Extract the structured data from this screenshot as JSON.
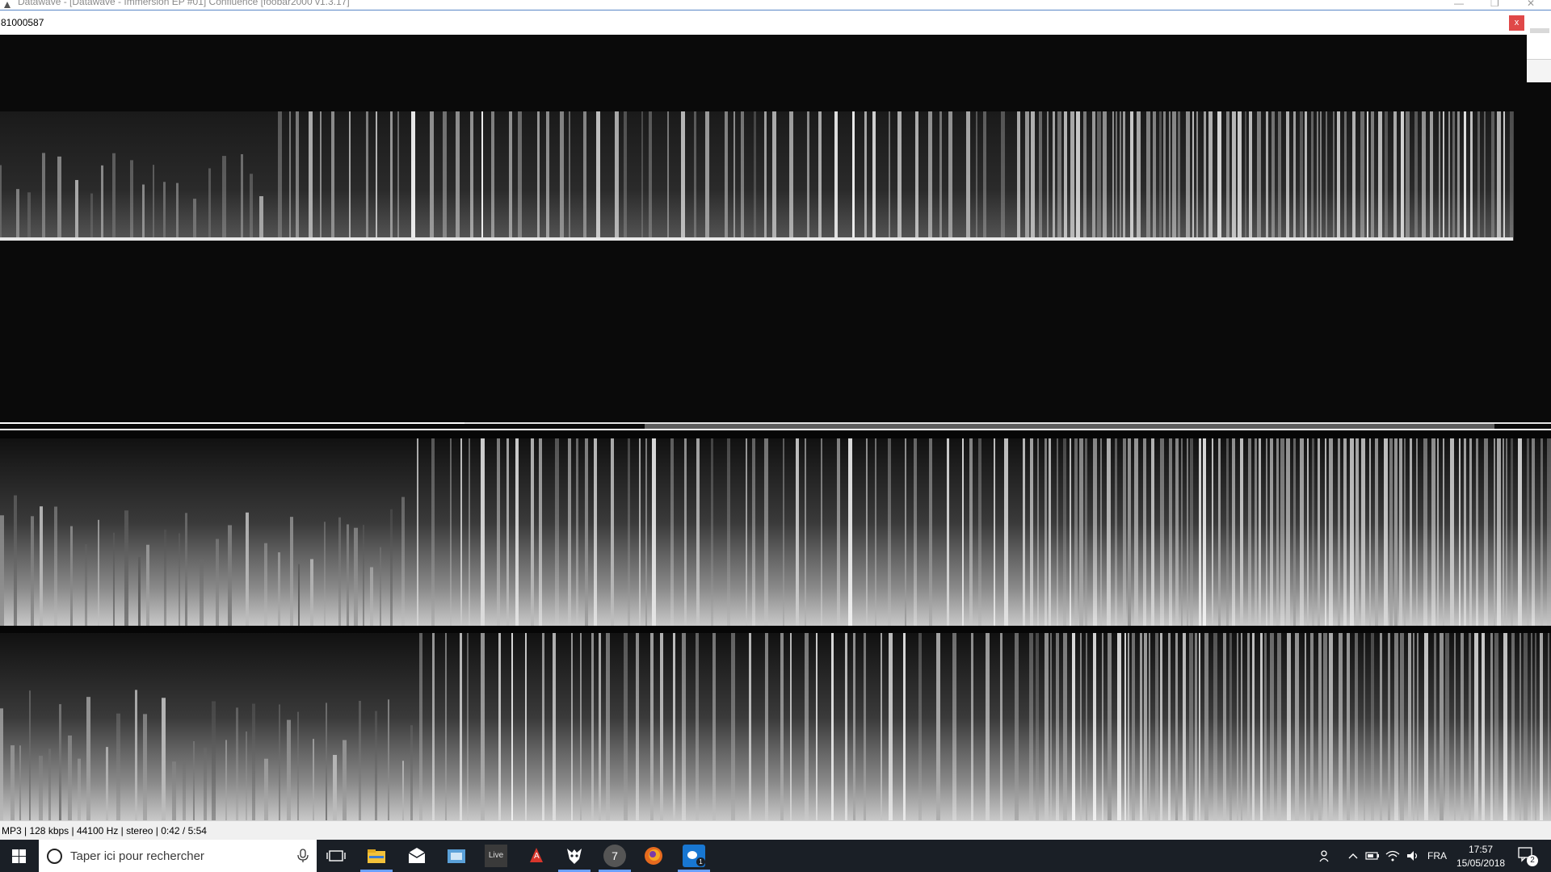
{
  "window": {
    "title": "Datawave - [Datawave - Immersion EP #01] Confluence  [foobar2000 v1.3.17]",
    "panel_name": "81000587",
    "close_glyph": "x",
    "min_glyph": "—",
    "max_glyph": "❐",
    "winclose_glyph": "✕"
  },
  "playback": {
    "position_fraction": 0.3,
    "spectrogram_panels": [
      "spectrogram-mono",
      "spectrogram-left",
      "spectrogram-right"
    ]
  },
  "status_bar": {
    "text": "MP3 | 128 kbps | 44100 Hz | stereo | 0:42 / 5:54"
  },
  "taskbar": {
    "search_placeholder": "Taper ici pour rechercher",
    "apps": [
      {
        "name": "task-view-icon",
        "label": ""
      },
      {
        "name": "file-explorer-icon",
        "label": ""
      },
      {
        "name": "mail-icon",
        "label": ""
      },
      {
        "name": "store-icon",
        "label": ""
      },
      {
        "name": "ableton-live-icon",
        "label": "Live"
      },
      {
        "name": "app-a-icon",
        "label": "A"
      },
      {
        "name": "foobar-icon",
        "label": ""
      },
      {
        "name": "app-7-icon",
        "label": "7"
      },
      {
        "name": "firefox-icon",
        "label": ""
      },
      {
        "name": "messenger-icon",
        "label": "1"
      }
    ],
    "tray": {
      "language": "FRA",
      "time": "17:57",
      "date": "15/05/2018",
      "notifications": "2"
    }
  }
}
